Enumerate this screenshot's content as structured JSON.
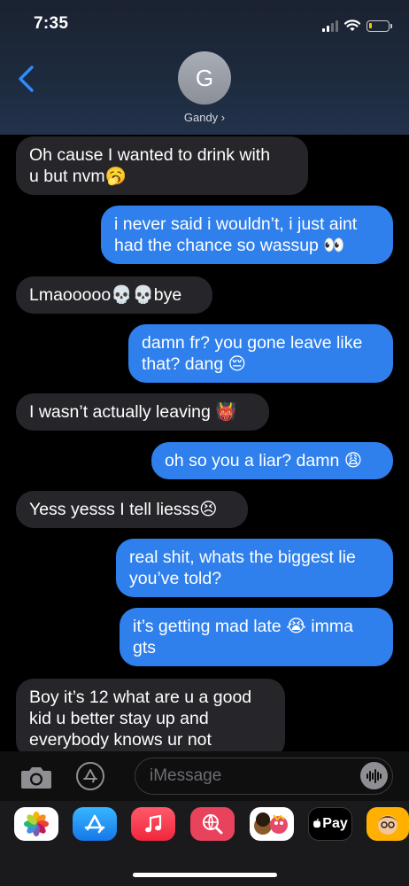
{
  "status": {
    "time": "7:35"
  },
  "header": {
    "avatar_letter": "G",
    "contact_name": "Gandy ›"
  },
  "messages": [
    {
      "from": "them",
      "lines": [
        "Oh cause I wanted to drink with",
        "u but nvm🥱"
      ]
    },
    {
      "from": "me",
      "lines": [
        "i never said i wouldn’t, i just aint",
        "had the chance so wassup 👀"
      ]
    },
    {
      "from": "them",
      "lines": [
        "Lmaooooo💀💀bye"
      ]
    },
    {
      "from": "me",
      "lines": [
        "damn fr? you gone leave like",
        "that? dang 😔"
      ]
    },
    {
      "from": "them",
      "lines": [
        "I wasn’t actually leaving 👹"
      ]
    },
    {
      "from": "me",
      "lines": [
        "oh so you a liar? damn 😩"
      ]
    },
    {
      "from": "them",
      "lines": [
        "Yess yesss I tell liesss😣"
      ]
    },
    {
      "from": "me",
      "lines": [
        "real shit, whats the biggest lie",
        "you’ve told?"
      ]
    },
    {
      "from": "me",
      "lines": [
        "it’s getting mad late 😭 imma",
        "gts"
      ]
    },
    {
      "from": "them",
      "lines": [
        "Boy it’s 12 what are u a good",
        "kid u better stay up and",
        "everybody knows ur not"
      ]
    }
  ],
  "composer": {
    "placeholder": "iMessage"
  },
  "app_tray": [
    {
      "name": "photos-app-icon"
    },
    {
      "name": "app-store-icon"
    },
    {
      "name": "music-app-icon"
    },
    {
      "name": "web-images-icon"
    },
    {
      "name": "memoji-stickers-icon"
    },
    {
      "name": "apple-pay-icon",
      "label": "Pay"
    },
    {
      "name": "animoji-icon"
    }
  ],
  "colors": {
    "outgoing_bubble": "#2f80ed",
    "incoming_bubble": "#26252a",
    "accent": "#3b82f6"
  }
}
